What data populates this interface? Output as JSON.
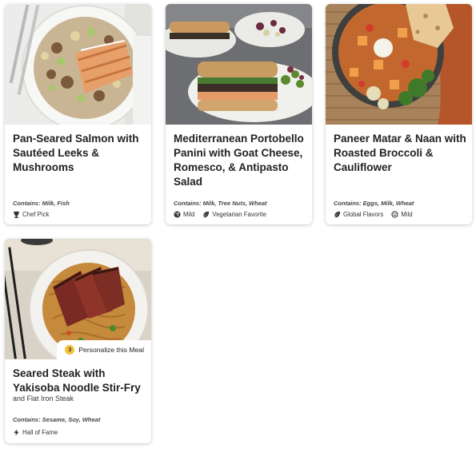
{
  "meals": [
    {
      "title": "Pan-Seared Salmon with Sautéed Leeks & Mushrooms",
      "contains": "Contains: Milk, Fish",
      "tags": [
        {
          "icon": "trophy-icon",
          "label": "Chef Pick"
        }
      ]
    },
    {
      "title": "Mediterranean Portobello Panini with Goat Cheese, Romesco, & Antipasto Salad",
      "contains": "Contains: Milk, Tree Nuts, Wheat",
      "tags": [
        {
          "icon": "globe-icon",
          "label": "Mild"
        },
        {
          "icon": "leaf-icon",
          "label": "Vegetarian Favorite"
        }
      ]
    },
    {
      "title": "Paneer Matar & Naan with Roasted Broccoli & Cauliflower",
      "contains": "Contains: Eggs, Milk, Wheat",
      "tags": [
        {
          "icon": "leaf-icon",
          "label": "Global Flavors"
        },
        {
          "icon": "smiley-icon",
          "label": "Mild"
        }
      ]
    },
    {
      "title": "Seared Steak with Yakisoba Noodle Stir-Fry",
      "subtitle": "and Flat Iron Steak",
      "contains": "Contains: Sesame, Soy, Wheat",
      "tags": [
        {
          "icon": "bolt-icon",
          "label": "Hall of Fame"
        }
      ],
      "personalize": {
        "count": "3",
        "label": "Personalize this Meal"
      }
    }
  ],
  "colors": {
    "badge": "#f3c13a",
    "card_shadow": "rgba(0,0,0,0.22)"
  }
}
